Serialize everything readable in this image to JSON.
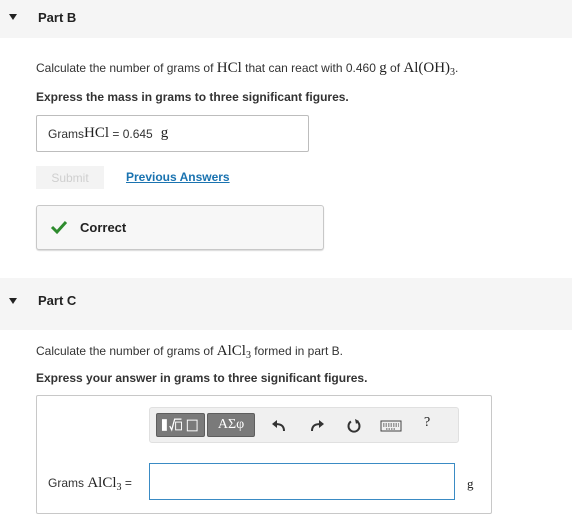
{
  "part_b": {
    "title": "Part B",
    "question_pre": "Calculate the number of grams of ",
    "question_compound1": "HCl",
    "question_mid": " that can react with 0.460 ",
    "question_unit": "g",
    "question_mid2": " of ",
    "question_compound2": "Al(OH)",
    "question_compound2_sub": "3",
    "question_end": ".",
    "instruction": "Express the mass in grams to three significant figures.",
    "answer_label": "Grams ",
    "answer_compound": "HCl",
    "answer_equals": " = ",
    "answer_value": "0.645",
    "answer_unit": "g",
    "submit_label": "Submit",
    "previous_answers_label": "Previous Answers",
    "feedback_label": "Correct"
  },
  "part_c": {
    "title": "Part C",
    "question_pre": "Calculate the number of grams of ",
    "question_compound": "AlCl",
    "question_compound_sub": "3",
    "question_end": " formed in part B.",
    "instruction": "Express your answer in grams to three significant figures.",
    "toolbar": {
      "greek_label": "ΑΣφ",
      "help_label": "?"
    },
    "input_label": "Grams ",
    "input_compound": "AlCl",
    "input_compound_sub": "3",
    "input_equals": " = ",
    "input_value": "",
    "unit": "g"
  },
  "colors": {
    "header_bg": "#f5f5f5",
    "link": "#1a73b0",
    "check": "#2e8b2e",
    "input_border": "#3a8bc4"
  }
}
